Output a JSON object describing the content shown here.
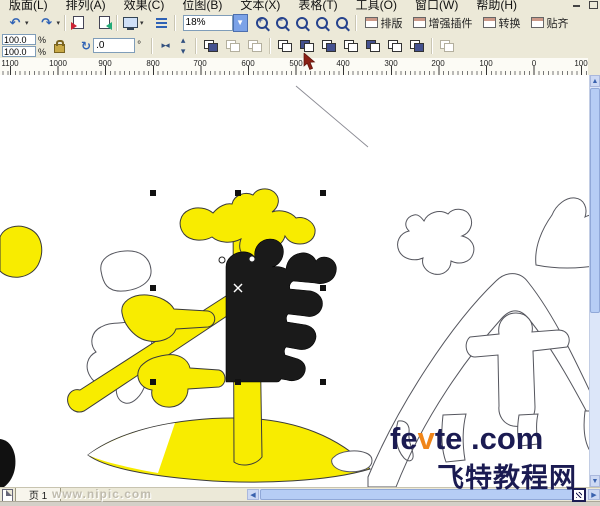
{
  "menu": {
    "items": [
      "版面(L)",
      "排列(A)",
      "效果(C)",
      "位图(B)",
      "文本(X)",
      "表格(T)",
      "工具(O)",
      "窗口(W)",
      "帮助(H)"
    ]
  },
  "toolbar": {
    "zoom_value": "18%",
    "macro_buttons": [
      "排版",
      "增强插件",
      "转换",
      "贴齐"
    ]
  },
  "property_bar": {
    "scale_h": "100.0",
    "scale_v": "100.0",
    "percent": "%",
    "rotation_value": ".0",
    "degree": "°"
  },
  "ruler": {
    "labels": [
      "1100",
      "1000",
      "900",
      "800",
      "700",
      "600",
      "500",
      "400",
      "300",
      "200",
      "100",
      "0",
      "100"
    ]
  },
  "page_bar": {
    "page_label": "页 1"
  },
  "watermark": {
    "brand_pre": "fe",
    "brand_accent": "v",
    "brand_post": "te .com",
    "brand_cn": "飞特教程网",
    "nipic": "www.nipic.com"
  },
  "colors": {
    "object_yellow": "#f8ec00",
    "selection_black": "#1a1a1a",
    "watermark_navy": "#1b1b52",
    "watermark_orange": "#f08519",
    "ui_beige": "#ece9d8",
    "scrollbar_blue": "#b6cdf5"
  }
}
